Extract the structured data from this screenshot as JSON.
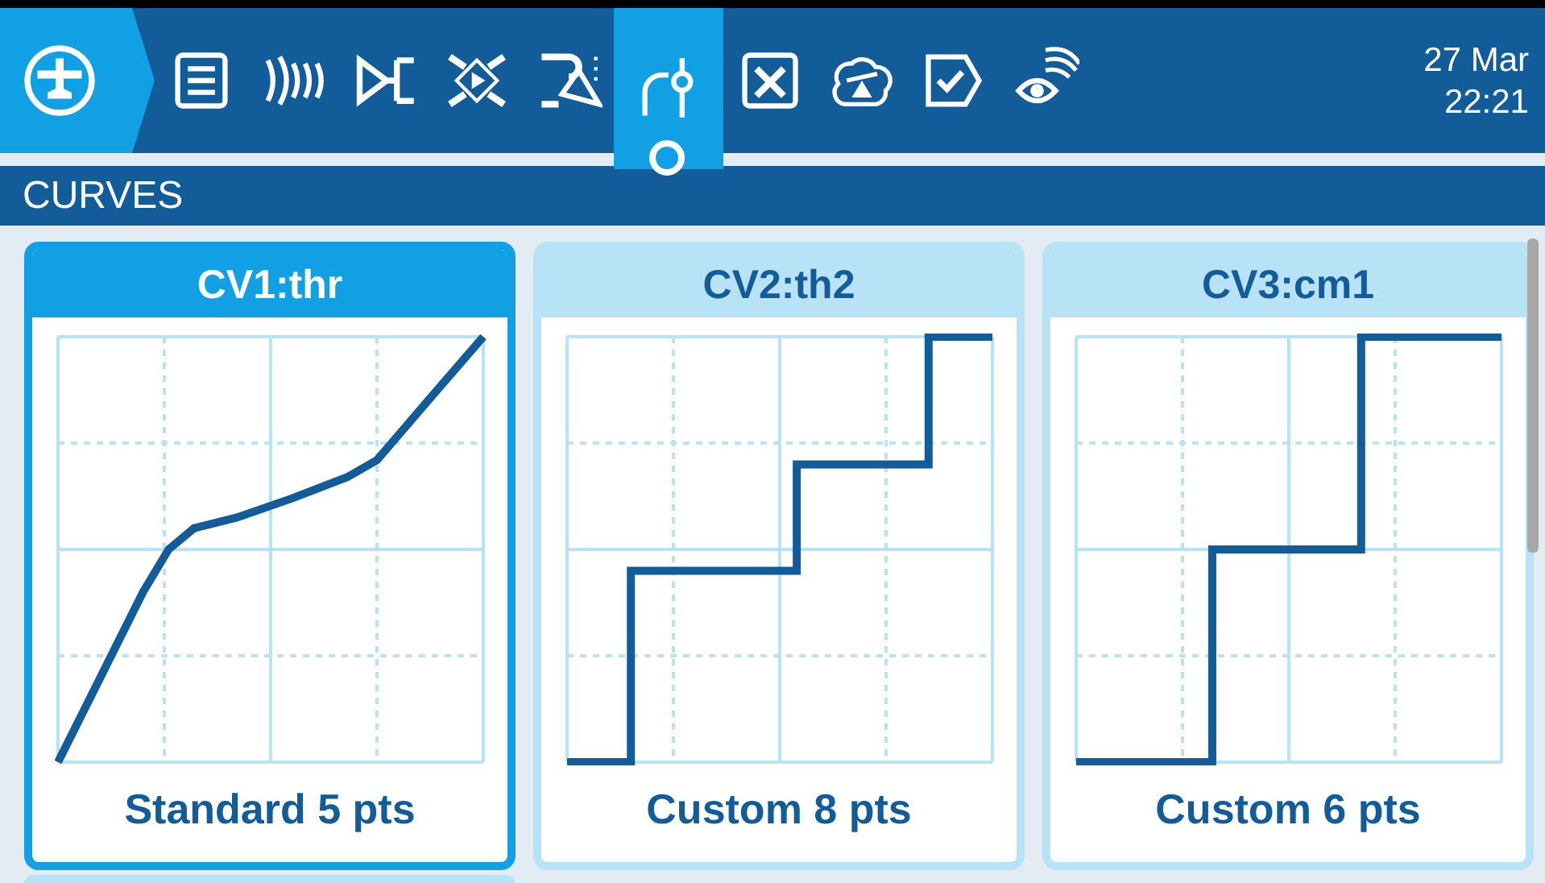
{
  "top_bar": {
    "tabs": [
      {
        "selected": false
      },
      {
        "selected": false
      },
      {
        "selected": false
      },
      {
        "selected": false
      },
      {
        "selected": false
      },
      {
        "selected": false
      },
      {
        "selected": true
      },
      {
        "selected": false
      },
      {
        "selected": false
      },
      {
        "selected": false
      },
      {
        "selected": false
      }
    ],
    "date": "27 Mar",
    "time": "22:21"
  },
  "section": {
    "title": "CURVES"
  },
  "cards": [
    {
      "title": "CV1:thr",
      "subtitle": "Standard 5 pts",
      "selected": true
    },
    {
      "title": "CV2:th2",
      "subtitle": "Custom 8 pts",
      "selected": false
    },
    {
      "title": "CV3:cm1",
      "subtitle": "Custom 6 pts",
      "selected": false
    }
  ]
}
